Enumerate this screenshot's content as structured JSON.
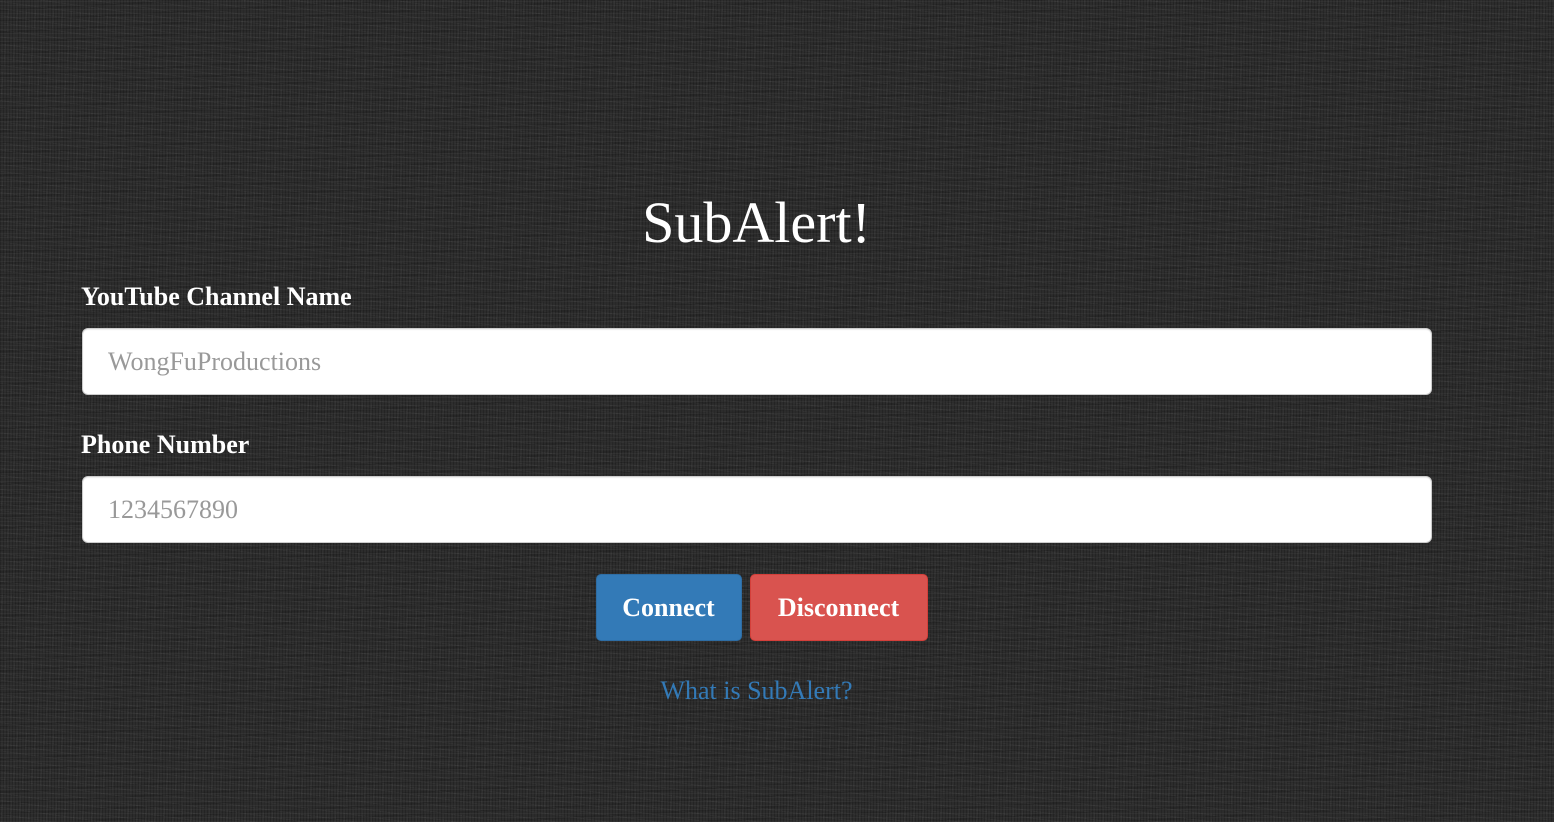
{
  "app": {
    "title": "SubAlert!"
  },
  "form": {
    "channel": {
      "label": "YouTube Channel Name",
      "value": "",
      "placeholder": "WongFuProductions"
    },
    "phone": {
      "label": "Phone Number",
      "value": "",
      "placeholder": "1234567890"
    }
  },
  "actions": {
    "connect_label": "Connect",
    "disconnect_label": "Disconnect"
  },
  "links": {
    "about_label": "What is SubAlert?"
  },
  "colors": {
    "background": "#2c2c2c",
    "primary": "#337ab7",
    "danger": "#d9534f",
    "link": "#337ab7"
  }
}
